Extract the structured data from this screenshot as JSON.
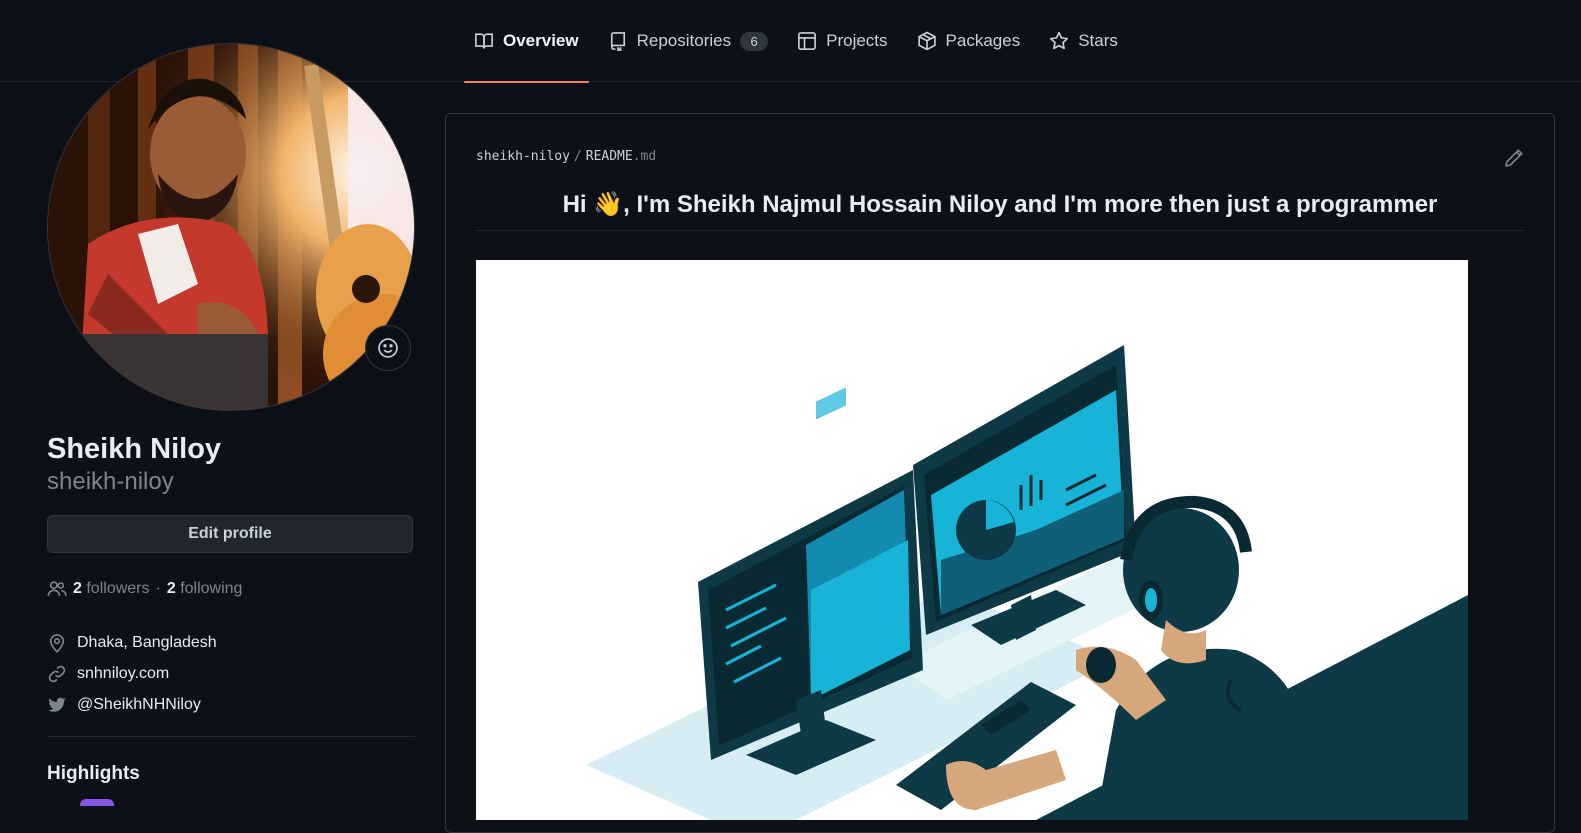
{
  "nav": {
    "tabs": [
      {
        "label": "Overview",
        "icon": "book-icon",
        "active": true
      },
      {
        "label": "Repositories",
        "icon": "repo-icon",
        "count": "6"
      },
      {
        "label": "Projects",
        "icon": "table-icon"
      },
      {
        "label": "Packages",
        "icon": "package-icon"
      },
      {
        "label": "Stars",
        "icon": "star-icon"
      }
    ]
  },
  "profile": {
    "name": "Sheikh Niloy",
    "login": "sheikh-niloy",
    "edit_label": "Edit profile",
    "followers_count": "2",
    "followers_label": "followers",
    "separator": "·",
    "following_count": "2",
    "following_label": "following",
    "location": "Dhaka, Bangladesh",
    "website": "snhniloy.com",
    "twitter": "@SheikhNHNiloy",
    "highlights_title": "Highlights"
  },
  "readme": {
    "owner": "sheikh-niloy",
    "sep": "/",
    "file_base": "README",
    "file_ext": ".md",
    "heading": "Hi 👋, I'm Sheikh Najmul Hossain Niloy and I'm more then just a programmer"
  },
  "colors": {
    "background": "#0d1117",
    "accent_underline": "#f78166",
    "illustration_dark": "#0e3a47",
    "illustration_cyan": "#18b4d8"
  }
}
